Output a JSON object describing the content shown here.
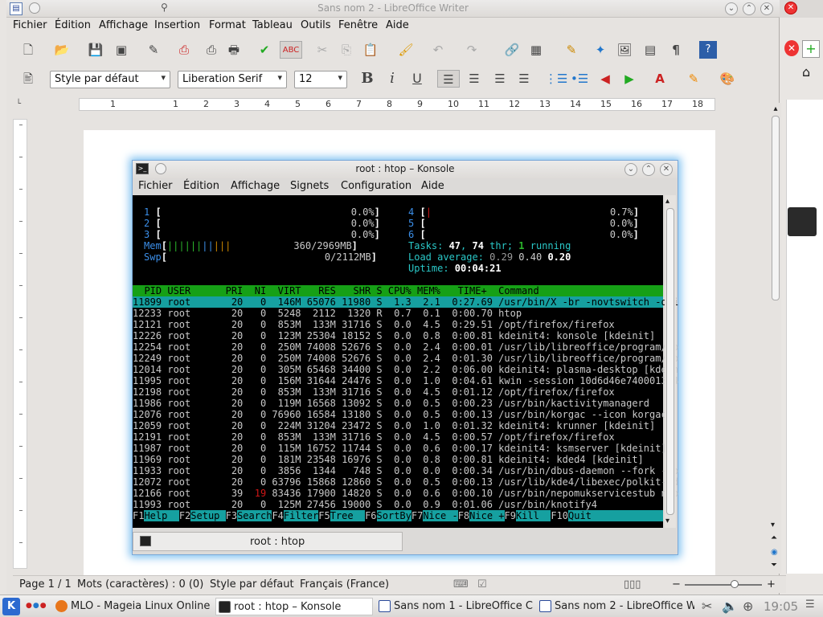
{
  "colors": {
    "accent": "#2ac8c8",
    "htop_header": "#16a016",
    "htop_selected": "#16a0a0",
    "glow": "#7ec0f0"
  },
  "writer": {
    "title": "Sans nom 2 - LibreOffice Writer",
    "menu": [
      "Fichier",
      "Édition",
      "Affichage",
      "Insertion",
      "Format",
      "Tableau",
      "Outils",
      "Fenêtre",
      "Aide"
    ],
    "style_value": "Style par défaut",
    "font_value": "Liberation Serif",
    "size_value": "12",
    "ruler_ticks": [
      "1",
      "1",
      "2",
      "3",
      "4",
      "5",
      "6",
      "7",
      "8",
      "9",
      "10",
      "11",
      "12",
      "13",
      "14",
      "15",
      "16",
      "17",
      "18"
    ],
    "status": {
      "page": "Page 1 / 1",
      "words": "Mots (caractères) : 0 (0)",
      "style": "Style par défaut",
      "lang": "Français (France)"
    }
  },
  "konsole": {
    "title": "root : htop – Konsole",
    "menu": [
      "Fichier",
      "Édition",
      "Affichage",
      "Signets",
      "Configuration",
      "Aide"
    ],
    "tab": "root : htop"
  },
  "htop": {
    "cpus": [
      {
        "n": "1",
        "v": "0.0%"
      },
      {
        "n": "2",
        "v": "0.0%"
      },
      {
        "n": "3",
        "v": "0.0%"
      },
      {
        "n": "4",
        "v": "0.7%"
      },
      {
        "n": "5",
        "v": "0.0%"
      },
      {
        "n": "6",
        "v": "0.0%"
      }
    ],
    "mem": "360/2969MB",
    "swp": "0/2112MB",
    "tasks": "47",
    "thr": "74",
    "running": "1",
    "load": [
      "0.29",
      "0.40",
      "0.20"
    ],
    "uptime": "00:04:21",
    "header": "  PID USER      PRI  NI  VIRT   RES   SHR S CPU% MEM%   TIME+  Command",
    "rows": [
      "11899 root       20   0  146M 65076 11980 S  1.3  2.1  0:27.69 /usr/bin/X -br -novtswitch -qui",
      "12233 root       20   0  5248  2112  1320 R  0.7  0.1  0:00.70 htop",
      "12121 root       20   0  853M  133M 31716 S  0.0  4.5  0:29.51 /opt/firefox/firefox",
      "12226 root       20   0  123M 25304 18152 S  0.0  0.8  0:00.81 kdeinit4: konsole [kdeinit]",
      "12254 root       20   0  250M 74008 52676 S  0.0  2.4  0:00.01 /usr/lib/libreoffice/program/so",
      "12249 root       20   0  250M 74008 52676 S  0.0  2.4  0:01.30 /usr/lib/libreoffice/program/so",
      "12014 root       20   0  305M 65468 34400 S  0.0  2.2  0:06.00 kdeinit4: plasma-desktop [kdein",
      "11995 root       20   0  156M 31644 24476 S  0.0  1.0  0:04.61 kwin -session 10d6d46e740001384",
      "12198 root       20   0  853M  133M 31716 S  0.0  4.5  0:01.12 /opt/firefox/firefox",
      "11986 root       20   0  119M 16568 13092 S  0.0  0.5  0:00.23 /usr/bin/kactivitymanagerd",
      "12076 root       20   0 76960 16584 13180 S  0.0  0.5  0:00.13 /usr/bin/korgac --icon korgac",
      "12059 root       20   0  224M 31204 23472 S  0.0  1.0  0:01.32 kdeinit4: krunner [kdeinit]",
      "12191 root       20   0  853M  133M 31716 S  0.0  4.5  0:00.57 /opt/firefox/firefox",
      "11987 root       20   0  115M 16752 11744 S  0.0  0.6  0:00.17 kdeinit4: ksmserver [kdeinit]",
      "11969 root       20   0  181M 23548 16976 S  0.0  0.8  0:00.81 kdeinit4: kded4 [kdeinit]",
      "11933 root       20   0  3856  1344   748 S  0.0  0.0  0:00.34 /usr/bin/dbus-daemon --fork --p",
      "12072 root       20   0 63796 15868 12860 S  0.0  0.5  0:00.13 /usr/lib/kde4/libexec/polkit-kd",
      "12166 root       39  19 83436 17900 14820 S  0.0  0.6  0:00.10 /usr/bin/nepomukservicestub nep",
      "11993 root       20   0  125M 27456 19000 S  0.0  0.9  0:01.06 /usr/bin/knotify4"
    ],
    "fkeys": [
      [
        "F1",
        "Help  "
      ],
      [
        "F2",
        "Setup "
      ],
      [
        "F3",
        "Search"
      ],
      [
        "F4",
        "Filter"
      ],
      [
        "F5",
        "Tree  "
      ],
      [
        "F6",
        "SortBy"
      ],
      [
        "F7",
        "Nice -"
      ],
      [
        "F8",
        "Nice +"
      ],
      [
        "F9",
        "Kill  "
      ],
      [
        "F10",
        "Quit"
      ]
    ]
  },
  "taskbar": {
    "tasks": [
      "MLO - Mageia Linux Online",
      "root : htop – Konsole",
      "Sans nom 1 - LibreOffice C",
      "Sans nom 2 - LibreOffice W"
    ],
    "clock": "19:05"
  }
}
